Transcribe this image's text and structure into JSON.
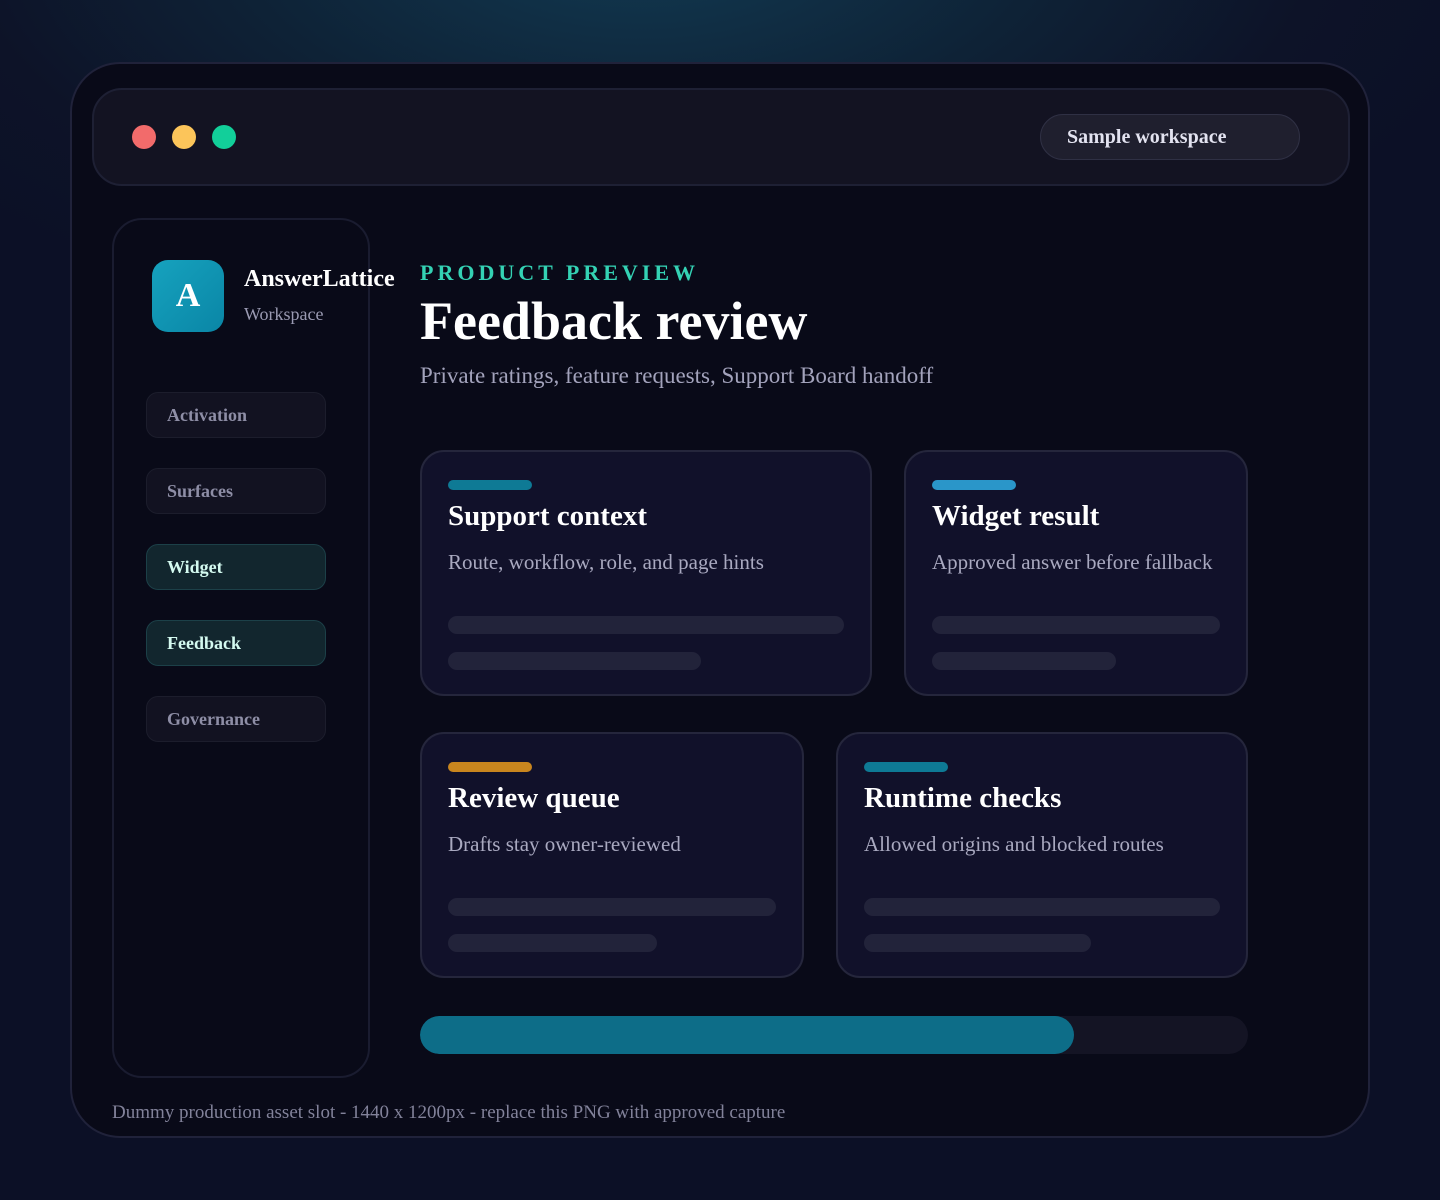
{
  "titlebar": {
    "workspace_label": "Sample workspace"
  },
  "brand": {
    "logo_letter": "A",
    "name": "AnswerLattice",
    "subtitle": "Workspace"
  },
  "sidebar": {
    "items": [
      {
        "label": "Activation",
        "active": false
      },
      {
        "label": "Surfaces",
        "active": false
      },
      {
        "label": "Widget",
        "active": true
      },
      {
        "label": "Feedback",
        "active": true
      },
      {
        "label": "Governance",
        "active": false
      }
    ]
  },
  "header": {
    "eyebrow": "PRODUCT PREVIEW",
    "title": "Feedback review",
    "subtitle": "Private ratings, feature requests, Support Board handoff"
  },
  "cards": [
    {
      "title": "Support context",
      "description": "Route, workflow, role, and page hints",
      "accent_color": "#0e7a95"
    },
    {
      "title": "Widget result",
      "description": "Approved answer before fallback",
      "accent_color": "#2a96c9"
    },
    {
      "title": "Review queue",
      "description": "Drafts stay owner-reviewed",
      "accent_color": "#c9861e"
    },
    {
      "title": "Runtime checks",
      "description": "Allowed origins and blocked routes",
      "accent_color": "#0e7a95"
    }
  ],
  "progress": {
    "percent": 79
  },
  "footer": {
    "note": "Dummy production asset slot - 1440 x 1200px - replace this PNG with approved capture"
  },
  "icons": {
    "close": "red-dot-icon",
    "minimize": "yellow-dot-icon",
    "maximize": "green-dot-icon"
  }
}
